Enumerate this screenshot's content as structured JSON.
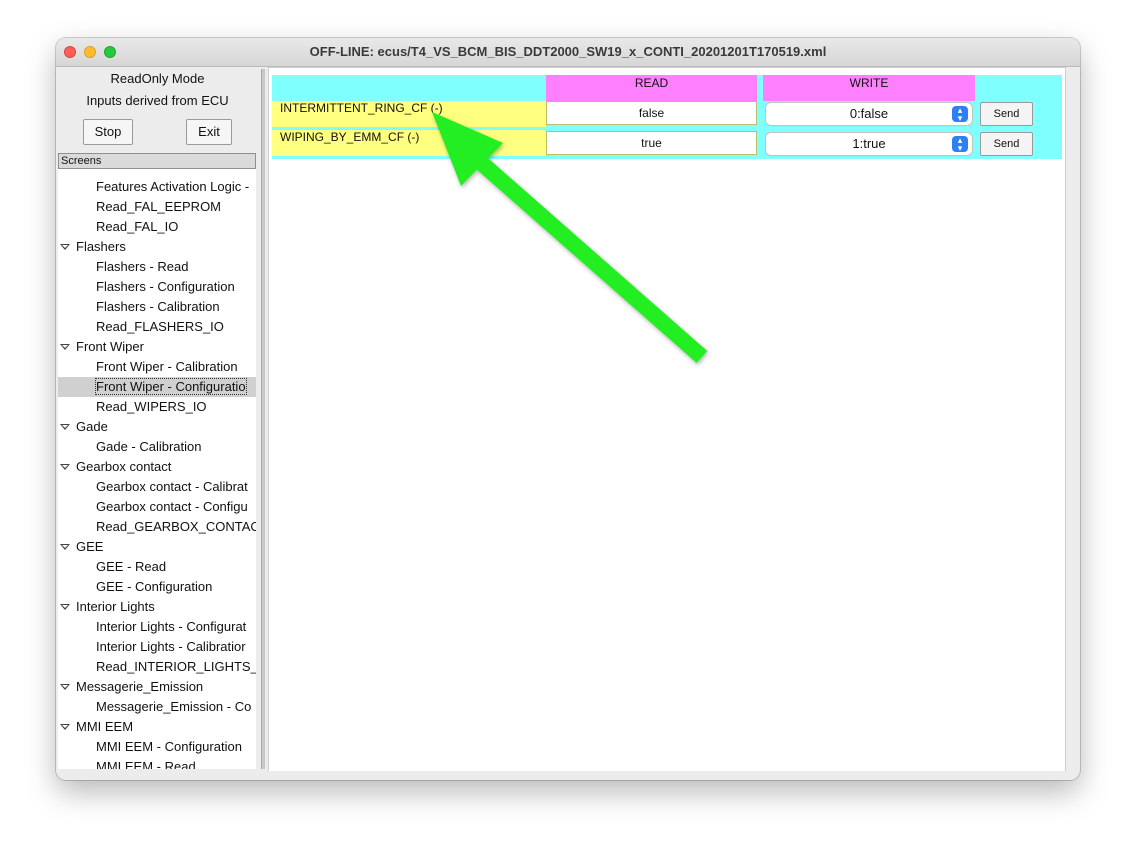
{
  "window": {
    "title": "OFF-LINE: ecus/T4_VS_BCM_BIS_DDT2000_SW19_x_CONTI_20201201T170519.xml"
  },
  "left_panel": {
    "mode_label": "ReadOnly Mode",
    "inputs_label": "Inputs derived from ECU",
    "stop_label": "Stop",
    "exit_label": "Exit",
    "screens_header": "Screens"
  },
  "tree": {
    "rows": [
      {
        "label": "Features Activation Logic -",
        "type": "leaf"
      },
      {
        "label": "Read_FAL_EEPROM",
        "type": "leaf"
      },
      {
        "label": "Read_FAL_IO",
        "type": "leaf"
      },
      {
        "label": "Flashers",
        "type": "group"
      },
      {
        "label": "Flashers - Read",
        "type": "leaf"
      },
      {
        "label": "Flashers - Configuration",
        "type": "leaf"
      },
      {
        "label": "Flashers - Calibration",
        "type": "leaf"
      },
      {
        "label": "Read_FLASHERS_IO",
        "type": "leaf"
      },
      {
        "label": "Front Wiper",
        "type": "group"
      },
      {
        "label": "Front Wiper - Calibration",
        "type": "leaf"
      },
      {
        "label": "Front Wiper - Configuratio",
        "type": "leaf",
        "selected": true
      },
      {
        "label": "Read_WIPERS_IO",
        "type": "leaf"
      },
      {
        "label": "Gade",
        "type": "group"
      },
      {
        "label": "Gade - Calibration",
        "type": "leaf"
      },
      {
        "label": "Gearbox contact",
        "type": "group"
      },
      {
        "label": "Gearbox contact - Calibrat",
        "type": "leaf"
      },
      {
        "label": "Gearbox contact - Configu",
        "type": "leaf"
      },
      {
        "label": "Read_GEARBOX_CONTAC",
        "type": "leaf"
      },
      {
        "label": "GEE",
        "type": "group"
      },
      {
        "label": "GEE - Read",
        "type": "leaf"
      },
      {
        "label": "GEE - Configuration",
        "type": "leaf"
      },
      {
        "label": "Interior Lights",
        "type": "group"
      },
      {
        "label": "Interior Lights - Configurat",
        "type": "leaf"
      },
      {
        "label": "Interior Lights - Calibratior",
        "type": "leaf"
      },
      {
        "label": "Read_INTERIOR_LIGHTS_I",
        "type": "leaf"
      },
      {
        "label": "Messagerie_Emission",
        "type": "group"
      },
      {
        "label": "Messagerie_Emission - Co",
        "type": "leaf"
      },
      {
        "label": "MMI EEM",
        "type": "group"
      },
      {
        "label": "MMI EEM - Configuration",
        "type": "leaf"
      },
      {
        "label": "MMI EEM - Read",
        "type": "leaf"
      }
    ]
  },
  "grid": {
    "read_header": "READ",
    "write_header": "WRITE",
    "rows": [
      {
        "name": "INTERMITTENT_RING_CF (-)",
        "read_value": "false",
        "write_value": "0:false",
        "send_label": "Send"
      },
      {
        "name": "WIPING_BY_EMM_CF (-)",
        "read_value": "true",
        "write_value": "1:true",
        "send_label": "Send"
      }
    ]
  },
  "colors": {
    "grid_background": "#80ffff",
    "header_background": "#ff80ff",
    "name_background": "#ffff80",
    "annotation_arrow": "#22ee22"
  },
  "icons": {
    "select_chevron": "chevron-updown-icon",
    "tree_expander": "triangle-down-icon",
    "annotation": "arrow-icon"
  }
}
